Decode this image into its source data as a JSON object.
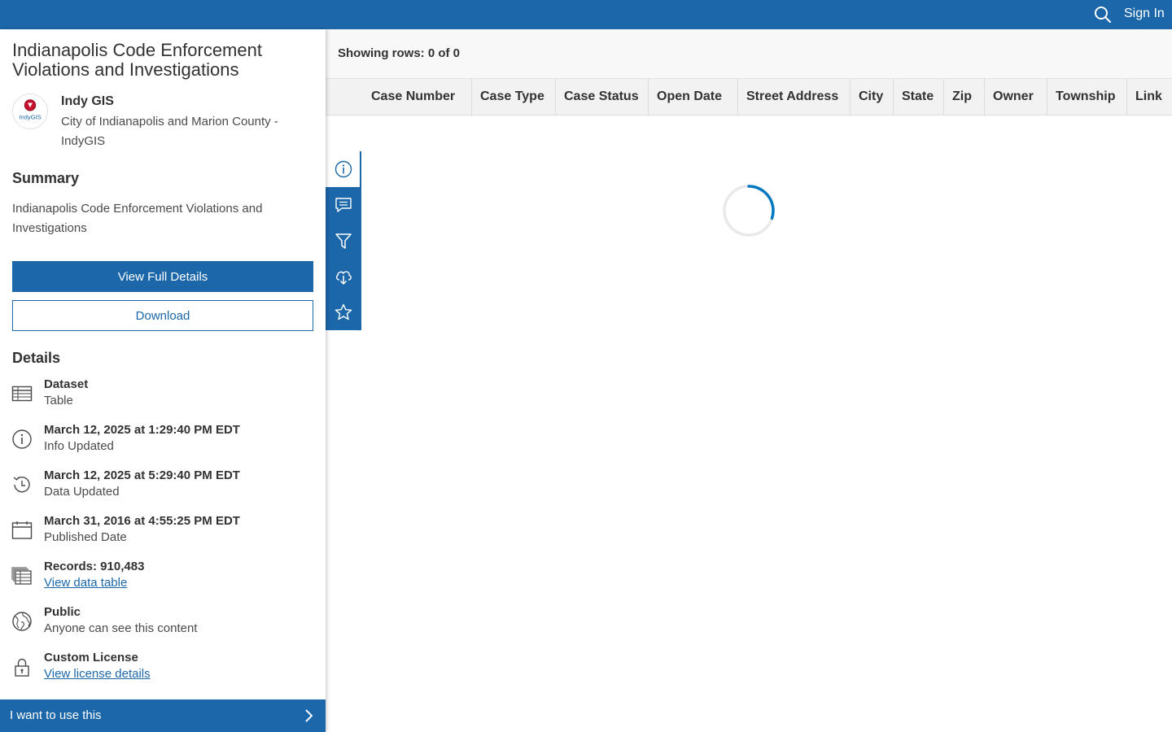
{
  "header": {
    "search_icon": "search-icon",
    "sign_in_label": "Sign In",
    "bar_color": "#1b67a9"
  },
  "item": {
    "title": "Indianapolis Code Enforcement Violations and Investigations",
    "logo_text": "IndyGIS",
    "owner": "Indy GIS",
    "organization": "City of Indianapolis and Marion County - IndyGIS"
  },
  "summary": {
    "heading": "Summary",
    "text": "Indianapolis Code Enforcement Violations and Investigations"
  },
  "actions": {
    "view_full_details": "View Full Details",
    "download": "Download"
  },
  "details": {
    "heading": "Details",
    "items": [
      {
        "icon": "table-icon",
        "main": "Dataset",
        "sub": "Table"
      },
      {
        "icon": "info-icon",
        "main": "March 12, 2025 at 1:29:40 PM EDT",
        "sub": "Info Updated"
      },
      {
        "icon": "history-icon",
        "main": "March 12, 2025 at 5:29:40 PM EDT",
        "sub": "Data Updated"
      },
      {
        "icon": "calendar-icon",
        "main": "March 31, 2016 at 4:55:25 PM EDT",
        "sub": "Published Date"
      },
      {
        "icon": "records-icon",
        "main": "Records: 910,483",
        "sub": "View data table"
      },
      {
        "icon": "globe-icon",
        "main": "Public",
        "sub": "Anyone can see this content"
      },
      {
        "icon": "lock-icon",
        "main": "Custom License",
        "sub": "View license details"
      }
    ]
  },
  "footer": {
    "use_label": "I want to use this",
    "icon": "chevron-right-icon"
  },
  "side_tabs": [
    {
      "name": "info-icon",
      "active": true
    },
    {
      "name": "comment-icon",
      "active": false
    },
    {
      "name": "filter-icon",
      "active": false
    },
    {
      "name": "cloud-download-icon",
      "active": false
    },
    {
      "name": "star-icon",
      "active": false
    }
  ],
  "table": {
    "rows_label": "Showing rows: 0 of 0",
    "columns": [
      "Case Number",
      "Case Type",
      "Case Status",
      "Open Date",
      "Street Address",
      "City",
      "State",
      "Zip",
      "Owner",
      "Township",
      "Link"
    ]
  },
  "colors": {
    "accent": "#1b67a9",
    "spinner": "#0079c1"
  }
}
